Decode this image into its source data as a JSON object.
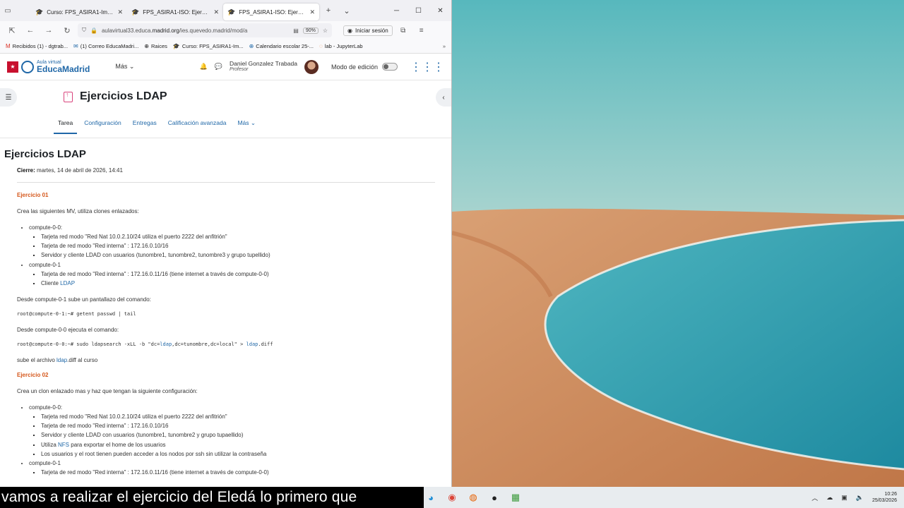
{
  "browser": {
    "tabs": [
      {
        "title": "Curso: FPS_ASIRA1-Implant",
        "active": false
      },
      {
        "title": "FPS_ASIRA1-ISO: Ejercicios",
        "active": false
      },
      {
        "title": "FPS_ASIRA1-ISO: Ejercicios",
        "active": true
      }
    ],
    "url_prefix": "aulavirtual33.educa.",
    "url_domain": "madrid.org",
    "url_suffix": "/ies.quevedo.madrid/mod/a",
    "zoom": "90%",
    "signin_label": "Iniciar sesión",
    "bookmarks": [
      {
        "label": "Recibidos (1) - dgtrab...",
        "icon": "gmail-icon"
      },
      {
        "label": "(1) Correo EducaMadri...",
        "icon": "mail-icon"
      },
      {
        "label": "Raices",
        "icon": "globe-icon"
      },
      {
        "label": "Curso: FPS_ASIRA1-Im...",
        "icon": "moodle-icon"
      },
      {
        "label": "Calendario escolar 25-...",
        "icon": "globe-icon"
      },
      {
        "label": "lab - JupyterLab",
        "icon": "jupyter-icon"
      }
    ]
  },
  "moodle": {
    "logo_sub": "Aula virtual",
    "logo_main": "EducaMadrid",
    "mas_label": "Más",
    "user_name": "Daniel Gonzalez Trabada",
    "user_role": "Profesor",
    "edit_mode_label": "Modo de edición",
    "page_title": "Ejercicios LDAP",
    "subnav": [
      "Tarea",
      "Configuración",
      "Entregas",
      "Calificación avanzada",
      "Más"
    ]
  },
  "content": {
    "heading": "Ejercicios LDAP",
    "due_label": "Cierre:",
    "due_value": "martes, 14 de abril de 2026, 14:41",
    "ex1": {
      "title": "Ejercicio 01",
      "intro": "Crea las siguientes MV, utiliza clones enlazados:",
      "node1": "compute-0-0:",
      "node1_items": [
        "Tarjeta red modo \"Red Nat 10.0.2.10/24 utiliza el puerto 2222 del anfitrión\"",
        "Tarjeta de red modo \"Red interna\" : 172.16.0.10/16",
        "Servidor y cliente LDAD con usuarios (tunombre1, tunombre2, tunombre3 y grupo tupellido)"
      ],
      "node2": "compute-0-1",
      "node2_item1": "Tarjeta de red modo \"Red interna\" : 172.16.0.11/16 (tiene internet a través de compute-0-0)",
      "node2_item2_prefix": "Cliente ",
      "node2_item2_link": "LDAP",
      "step1": "Desde compute-0-1 sube un pantallazo del comando:",
      "cmd1": "root@compute-0-1:~# getent passwd | tail",
      "step2": "Desde compute-0-0 ejecuta el comando:",
      "cmd2_a": "root@compute-0-0:~# sudo ldapsearch -xLL -b \"dc=",
      "cmd2_link1": "ldap",
      "cmd2_b": ",dc=tunombre,dc=local\" > ",
      "cmd2_link2": "ldap",
      "cmd2_c": ".diff",
      "upload_a": "sube el archivo ",
      "upload_link": "ldap",
      "upload_b": ".diff al curso"
    },
    "ex2": {
      "title": "Ejercicio 02",
      "intro": "Crea un clon enlazado mas y haz que tengan la siguiente configuración:",
      "node1": "compute-0-0:",
      "node1_items": [
        "Tarjeta red modo \"Red Nat 10.0.2.10/24 utiliza el puerto 2222 del anfitrión\"",
        "Tarjeta de red modo \"Red interna\" : 172.16.0.10/16",
        "Servidor y cliente LDAD con usuarios (tunombre1, tunombre2 y grupo tupaellido)"
      ],
      "nfs_a": "Utiliza ",
      "nfs_link": "NFS",
      "nfs_b": " para exportar el home de los usuarios",
      "node1_last": "Los usuarios y el root tienen pueden acceder a los nodos por ssh sin utilizar la contraseña",
      "node2": "compute-0-1",
      "node2_item1": "Tarjeta de red modo \"Red interna\" : 172.16.0.11/16 (tiene internet a través de compute-0-0)"
    }
  },
  "caption": "vamos a realizar el ejercicio del Eledá lo primero que",
  "taskbar": {
    "time": "10:26",
    "date": "25/03/2026"
  },
  "colors": {
    "link": "#1f67a7",
    "exercise_title": "#d5571b",
    "brand_red": "#c8102e"
  }
}
